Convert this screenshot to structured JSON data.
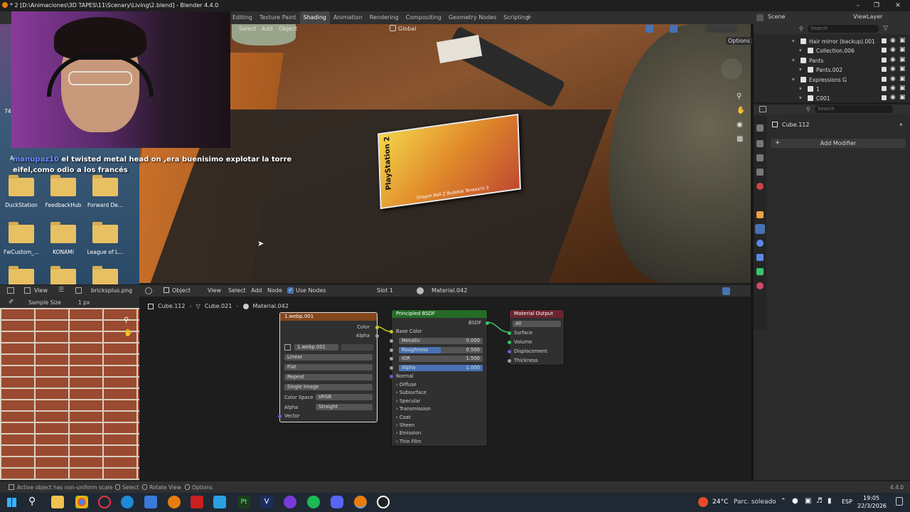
{
  "window": {
    "title": "* 2 [D:\\Animaciones\\3D TAPES\\11\\Scenary\\Living\\2.blend] - Blender 4.4.0"
  },
  "workspaces": [
    "Editing",
    "Texture Paint",
    "Shading",
    "Animation",
    "Rendering",
    "Compositing",
    "Geometry Nodes",
    "Scripting"
  ],
  "active_workspace": "Shading",
  "top_right": {
    "scene": "Scene",
    "view_layer": "ViewLayer"
  },
  "viewport": {
    "menu": [
      "Select",
      "Add",
      "Object"
    ],
    "orientation": "Global",
    "options_label": "Options",
    "game_box": {
      "brand": "PlayStation 2",
      "subtitle": "Dragon Ball Z Budokai Tenkaichi 3"
    }
  },
  "chat": {
    "username": "manupaz10",
    "message": "el twisted metal head on ,era buenisimo explotar la torre eifel,como odio a los francés"
  },
  "desktop_icons": [
    {
      "label": "DuckStation"
    },
    {
      "label": "FeedbackHub"
    },
    {
      "label": "Forward De..."
    },
    {
      "label": "FwCustom_..."
    },
    {
      "label": "KONAMI"
    },
    {
      "label": "League of L..."
    }
  ],
  "desktop_partial": [
    "74",
    "A"
  ],
  "outliner": {
    "search_placeholder": "Search",
    "items": [
      {
        "label": "Hair mirror (backup).001",
        "indent": 1
      },
      {
        "label": "Collection.006",
        "indent": 2
      },
      {
        "label": "Pants",
        "indent": 1
      },
      {
        "label": "Pants.002",
        "indent": 2
      },
      {
        "label": "Expressions G",
        "indent": 1
      },
      {
        "label": "1",
        "indent": 2
      },
      {
        "label": "C001",
        "indent": 2
      }
    ]
  },
  "properties": {
    "search_placeholder": "Search",
    "object_name": "Cube.112",
    "add_modifier": "Add Modifier"
  },
  "image_editor": {
    "view_label": "View",
    "image_name": "bricksplus.png",
    "sample_size_label": "Sample Size",
    "sample_size_value": "1 px"
  },
  "node_editor": {
    "mode": "Object",
    "menu": [
      "View",
      "Select",
      "Add",
      "Node"
    ],
    "use_nodes_label": "Use Nodes",
    "slot": "Slot 1",
    "material": "Material.042",
    "breadcrumb": [
      "Cube.112",
      "Cube.021",
      "Material.042"
    ],
    "image_node": {
      "title": "1.webp.001",
      "outputs": [
        "Color",
        "Alpha"
      ],
      "image_field": "1.webp.001",
      "interpolation": "Linear",
      "projection": "Flat",
      "extension": "Repeat",
      "source": "Single Image",
      "color_space_label": "Color Space",
      "color_space_value": "sRGB",
      "alpha_label": "Alpha",
      "alpha_value": "Straight",
      "vector_label": "Vector"
    },
    "bsdf_node": {
      "title": "Principled BSDF",
      "output": "BSDF",
      "base_color": "Base Color",
      "fields": [
        {
          "label": "Metallic",
          "value": "0.000",
          "fill": 0.0
        },
        {
          "label": "Roughness",
          "value": "0.500",
          "fill": 0.5
        },
        {
          "label": "IOR",
          "value": "1.500",
          "fill": 0.0
        },
        {
          "label": "Alpha",
          "value": "1.000",
          "fill": 1.0
        }
      ],
      "normal": "Normal",
      "panels": [
        "Diffuse",
        "Subsurface",
        "Specular",
        "Transmission",
        "Coat",
        "Sheen",
        "Emission",
        "Thin Film"
      ]
    },
    "output_node": {
      "title": "Material Output",
      "target": "All",
      "inputs": [
        "Surface",
        "Volume",
        "Displacement",
        "Thickness"
      ]
    }
  },
  "statusbar": {
    "message": "Active object has non-uniform scale",
    "hints": [
      "Select",
      "Rotate View",
      "Options"
    ],
    "version": "4.4.0"
  },
  "taskbar": {
    "weather_temp": "24°C",
    "weather_desc": "Parc. soleado",
    "language": "ESP",
    "time": "19:05",
    "date": "22/3/2026"
  },
  "colors": {
    "accent_blue": "#4772b3",
    "node_image_header": "#84471c",
    "node_bsdf_header": "#256b25",
    "node_output_header": "#6b2530"
  }
}
